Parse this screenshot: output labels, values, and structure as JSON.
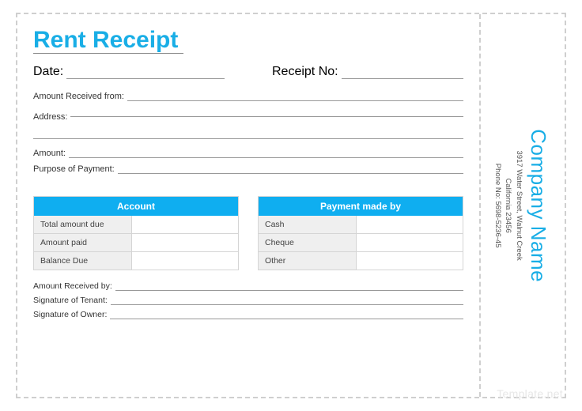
{
  "title": "Rent Receipt",
  "fields": {
    "date": "Date:",
    "receipt_no": "Receipt No:",
    "amount_received_from": "Amount Received from:",
    "address": "Address:",
    "amount": "Amount:",
    "purpose": "Purpose of Payment:"
  },
  "account_table": {
    "header": "Account",
    "rows": [
      "Total amount due",
      "Amount paid",
      "Balance Due"
    ]
  },
  "payment_table": {
    "header": "Payment made by",
    "rows": [
      "Cash",
      "Cheque",
      "Other"
    ]
  },
  "signatures": {
    "received_by": "Amount Received by:",
    "tenant": "Signature of Tenant:",
    "owner": "Signature of Owner:"
  },
  "stub": {
    "company": "Company Name",
    "addr1": "3917 Water Street, Walnut Creek",
    "addr2": "California 23456",
    "phone": "Phone No: 5698-5236-45"
  },
  "watermark": "Template.net"
}
